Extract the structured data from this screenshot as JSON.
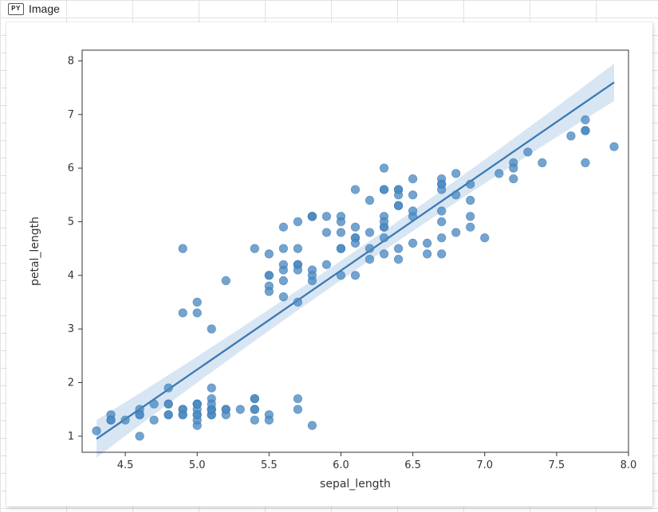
{
  "cell": {
    "badge": "PY",
    "type_label": "Image"
  },
  "chart_data": {
    "type": "scatter",
    "xlabel": "sepal_length",
    "ylabel": "petal_length",
    "xlim": [
      4.2,
      8.0
    ],
    "ylim": [
      0.7,
      8.2
    ],
    "xticks": [
      4.5,
      5.0,
      5.5,
      6.0,
      6.5,
      7.0,
      7.5,
      8.0
    ],
    "yticks": [
      1,
      2,
      3,
      4,
      5,
      6,
      7,
      8
    ],
    "series": [
      {
        "name": "points",
        "x": [
          5.1,
          4.9,
          4.7,
          4.6,
          5.0,
          5.4,
          4.6,
          5.0,
          4.4,
          4.9,
          5.4,
          4.8,
          4.8,
          4.3,
          5.8,
          5.7,
          5.4,
          5.1,
          5.7,
          5.1,
          5.4,
          5.1,
          4.6,
          5.1,
          4.8,
          5.0,
          5.0,
          5.2,
          5.2,
          4.7,
          4.8,
          5.4,
          5.2,
          5.5,
          4.9,
          5.0,
          5.5,
          4.9,
          4.4,
          5.1,
          5.0,
          4.5,
          4.4,
          5.0,
          5.1,
          4.8,
          5.1,
          4.6,
          5.3,
          5.0,
          7.0,
          6.4,
          6.9,
          5.5,
          6.5,
          5.7,
          6.3,
          4.9,
          6.6,
          5.2,
          5.0,
          5.9,
          6.0,
          6.1,
          5.6,
          6.7,
          5.6,
          5.8,
          6.2,
          5.6,
          5.9,
          6.1,
          6.3,
          6.1,
          6.4,
          6.6,
          6.8,
          6.7,
          6.0,
          5.7,
          5.5,
          5.5,
          5.8,
          6.0,
          5.4,
          6.0,
          6.7,
          6.3,
          5.6,
          5.5,
          5.5,
          6.1,
          5.8,
          5.0,
          5.6,
          5.7,
          5.7,
          6.2,
          5.1,
          5.7,
          6.3,
          5.8,
          7.1,
          6.3,
          6.5,
          7.6,
          4.9,
          7.3,
          6.7,
          7.2,
          6.5,
          6.4,
          6.8,
          5.7,
          5.8,
          6.4,
          6.5,
          7.7,
          7.7,
          6.0,
          6.9,
          5.6,
          7.7,
          6.3,
          6.7,
          7.2,
          6.2,
          6.1,
          6.4,
          7.2,
          7.4,
          7.9,
          6.4,
          6.3,
          6.1,
          7.7,
          6.3,
          6.4,
          6.0,
          6.9,
          6.7,
          6.9,
          5.8,
          6.8,
          6.7,
          6.7,
          6.3,
          6.5,
          6.2,
          5.9
        ],
        "y": [
          1.4,
          1.4,
          1.3,
          1.5,
          1.4,
          1.7,
          1.4,
          1.5,
          1.4,
          1.5,
          1.5,
          1.6,
          1.4,
          1.1,
          1.2,
          1.5,
          1.3,
          1.4,
          1.7,
          1.5,
          1.7,
          1.5,
          1.0,
          1.7,
          1.9,
          1.6,
          1.6,
          1.5,
          1.4,
          1.6,
          1.6,
          1.5,
          1.5,
          1.4,
          1.5,
          1.2,
          1.3,
          1.4,
          1.3,
          1.5,
          1.3,
          1.3,
          1.3,
          1.6,
          1.9,
          1.4,
          1.6,
          1.4,
          1.5,
          1.4,
          4.7,
          4.5,
          4.9,
          4.0,
          4.6,
          4.5,
          4.7,
          3.3,
          4.6,
          3.9,
          3.5,
          4.2,
          4.0,
          4.7,
          3.6,
          4.4,
          4.5,
          4.1,
          4.5,
          3.9,
          4.8,
          4.0,
          4.9,
          4.7,
          4.3,
          4.4,
          4.8,
          5.0,
          4.5,
          3.5,
          3.8,
          3.7,
          3.9,
          5.1,
          4.5,
          4.5,
          4.7,
          4.4,
          4.1,
          4.0,
          4.4,
          4.6,
          4.0,
          3.3,
          4.2,
          4.2,
          4.2,
          4.3,
          3.0,
          4.1,
          6.0,
          5.1,
          5.9,
          5.6,
          5.8,
          6.6,
          4.5,
          6.3,
          5.8,
          6.1,
          5.1,
          5.3,
          5.5,
          5.0,
          5.1,
          5.3,
          5.5,
          6.7,
          6.9,
          5.0,
          5.7,
          4.9,
          6.7,
          4.9,
          5.7,
          6.0,
          4.8,
          4.9,
          5.6,
          5.8,
          6.1,
          6.4,
          5.6,
          5.1,
          5.6,
          6.1,
          5.6,
          5.5,
          4.8,
          5.4,
          5.6,
          5.1,
          5.1,
          5.9,
          5.7,
          5.2,
          5.0,
          5.2,
          5.4,
          5.1
        ]
      }
    ],
    "regression": {
      "x1": 4.3,
      "y1": 0.95,
      "x2": 7.9,
      "y2": 7.6,
      "ci_half_width_at_x1": 0.35,
      "ci_half_width_at_x2": 0.35,
      "ci_half_width_mid": 0.18
    },
    "point_color": "#4c8bc3",
    "line_color": "#3a79b3",
    "ci_color": "#a9c7e4"
  }
}
